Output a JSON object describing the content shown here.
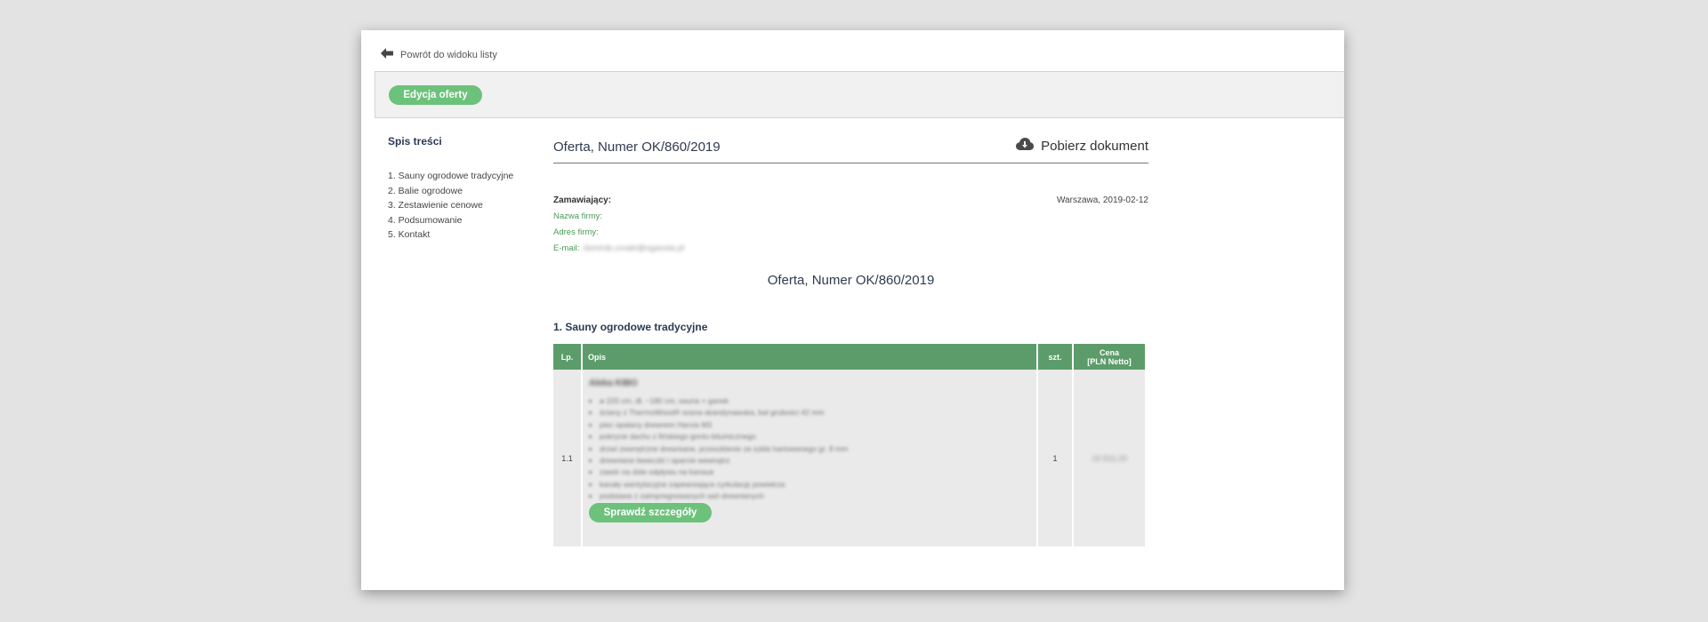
{
  "nav": {
    "back_label": "Powrót do widoku listy"
  },
  "toolbar": {
    "edit_label": "Edycja oferty"
  },
  "toc": {
    "title": "Spis treści",
    "items": [
      "1. Sauny ogrodowe tradycyjne",
      "2. Balie ogrodowe",
      "3. Zestawienie cenowe",
      "4. Podsumowanie",
      "5. Kontakt"
    ]
  },
  "offer": {
    "title": "Oferta, Numer OK/860/2019",
    "download_label": "Pobierz dokument",
    "client_label": "Zamawiający:",
    "date": "Warszawa, 2019-02-12",
    "company_label": "Nazwa firmy:",
    "address_label": "Adres firmy:",
    "email_label": "E-mail:",
    "email_value": "dominik.cmakt@sganola.pl",
    "center_title": "Oferta, Numer OK/860/2019"
  },
  "section1": {
    "title": "1. Sauny ogrodowe tradycyjne",
    "table": {
      "headers": {
        "lp": "Lp.",
        "desc": "Opis",
        "qty": "szt.",
        "price_line1": "Cena",
        "price_line2": "[PLN Netto]"
      },
      "rows": [
        {
          "lp": "1.1",
          "name": "Aleka KIBO",
          "features": [
            "ø 220 cm, dł. ~180 cm, sauna + ganek",
            "ściany z ThermoWood® sosna skandynawska, bal grubości 42 mm",
            "piec opalany drewnem Harvia M3",
            "pokrycie dachu z fińskiego gontu bitumicznego",
            "drzwi zewnętrzne drewniane, przeszklenie ze szkła hartowanego gr. 8 mm",
            "drewniane ławeczki i oparcie wewnątrz",
            "zawór na dole odpływu na kanaue",
            "kanały wentylacyjne zapewniające cyrkulację powietrza",
            "podstawa z zaimpregnowanych sań drewnianych"
          ],
          "details_label": "Sprawdź szczegóły",
          "qty": "1",
          "price": "18 816,39"
        }
      ]
    }
  }
}
